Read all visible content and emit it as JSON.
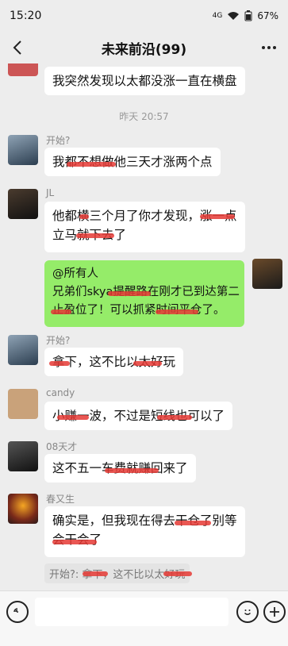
{
  "status": {
    "time": "15:20",
    "battery": "67%",
    "signal": "4G"
  },
  "header": {
    "title": "未来前沿(99)"
  },
  "messages": {
    "m1": "我突然发现以太都没涨一直在横盘",
    "timestamp": "昨天 20:57",
    "m2_name": "开始?",
    "m2": "我都不想做他三天才涨两个点",
    "m3_name": "JL",
    "m3_l1": "他都横三个月了你才发现，涨一点",
    "m3_l2": "立马就下去了",
    "m4_l1": "@所有人",
    "m4_l2": "兄弟们skya提醒路在刚才已到达第二",
    "m4_l3": "止盈位了！可以抓紧时间平仓了。",
    "m5_name": "开始?",
    "m5": "拿下，这不比以太好玩",
    "m6_name": "candy",
    "m6": "小赚一波，不过是短线也可以了",
    "m7_name": "08天才",
    "m7": "这不五一车费就赚回来了",
    "m8_name": "春又生",
    "m8_l1": "确实是，但我现在得去干仓了别等",
    "m8_l2": "会干会了",
    "quote": "开始?: 拿下，这不比以太好玩"
  }
}
